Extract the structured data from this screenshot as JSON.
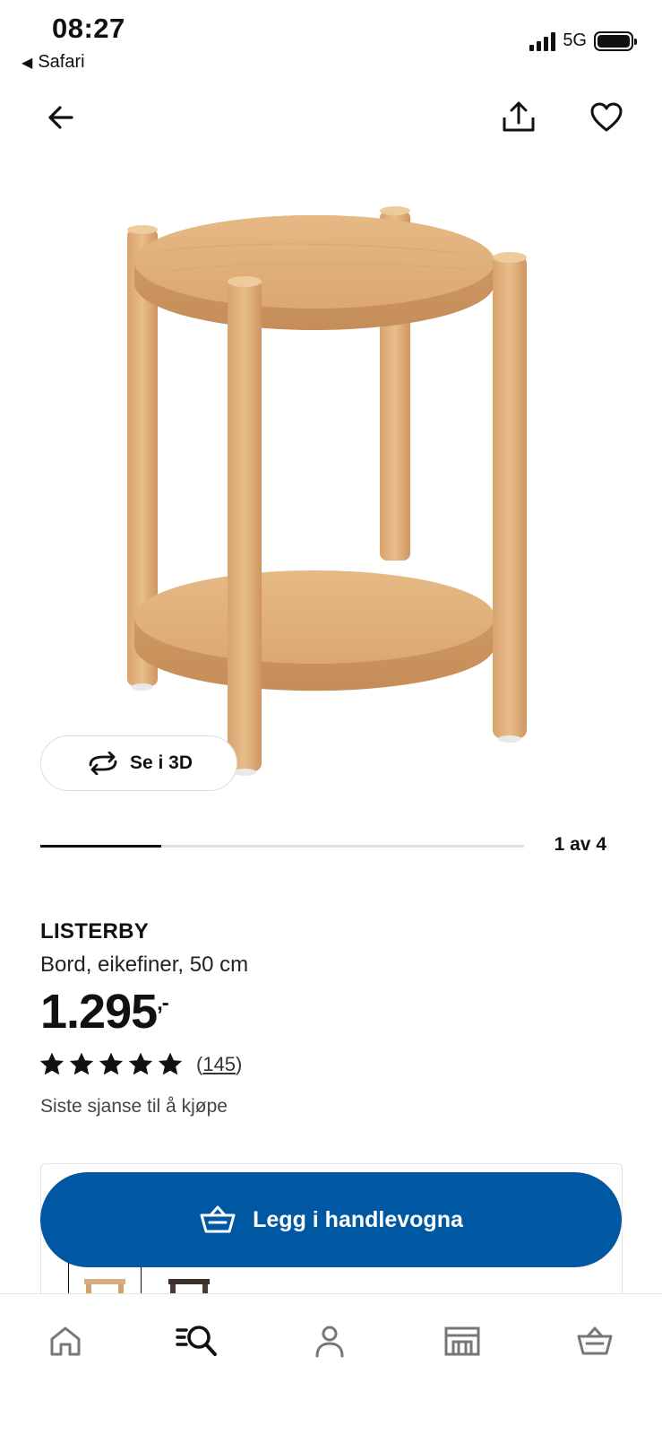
{
  "status_bar": {
    "time": "08:27",
    "back_app": "Safari",
    "network": "5G"
  },
  "nav": {
    "back_icon": "arrow-left-icon",
    "share_icon": "share-icon",
    "favorite_icon": "heart-icon"
  },
  "gallery": {
    "view_3d_label": "Se i 3D",
    "counter": "1 av 4",
    "progress": 0.25
  },
  "product": {
    "name": "LISTERBY",
    "description": "Bord, eikefiner, 50 cm",
    "price": "1.295",
    "price_suffix": ",-",
    "rating": 5,
    "reviews": "145",
    "note": "Siste sjanse til å kjøpe"
  },
  "cart": {
    "add_label": "Legg i handlevogna",
    "button_color": "#0058a3"
  },
  "tabs": [
    {
      "name": "home",
      "icon": "home-icon"
    },
    {
      "name": "search",
      "icon": "search-icon"
    },
    {
      "name": "profile",
      "icon": "user-icon"
    },
    {
      "name": "store",
      "icon": "store-icon"
    },
    {
      "name": "cart",
      "icon": "cart-icon"
    }
  ]
}
